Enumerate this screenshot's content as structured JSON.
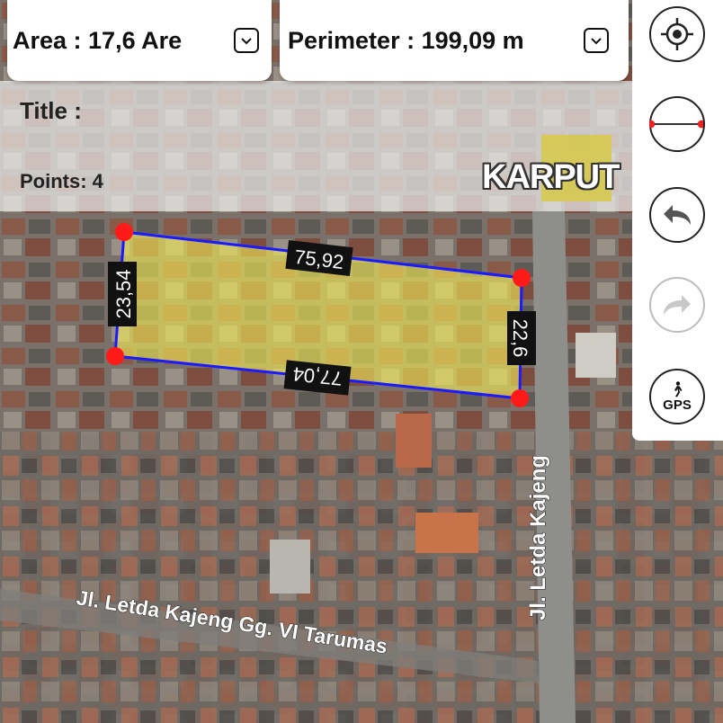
{
  "header": {
    "area_text": "Area : 17,6 Are",
    "perimeter_text": "Perimeter : 199,09 m"
  },
  "info": {
    "title_label": "Title :",
    "points_label": "Points: 4",
    "brand": "KARPUT"
  },
  "polygon": {
    "side_top": "75,92",
    "side_right": "22,6",
    "side_bottom": "77,04",
    "side_left": "23,54",
    "fill_color": "#f3ea57",
    "edge_color": "#1a1aff",
    "vertex_color": "#ff1a1a"
  },
  "map": {
    "street_vertical": "Jl. Letda Kajeng",
    "street_horizontal": "Jl. Letda Kajeng Gg. VI Tarumas"
  },
  "controls": {
    "locate_icon": "crosshair-icon",
    "measure_icon": "ruler-line-icon",
    "undo_icon": "undo-icon",
    "redo_icon": "redo-icon",
    "gps_label": "GPS"
  }
}
